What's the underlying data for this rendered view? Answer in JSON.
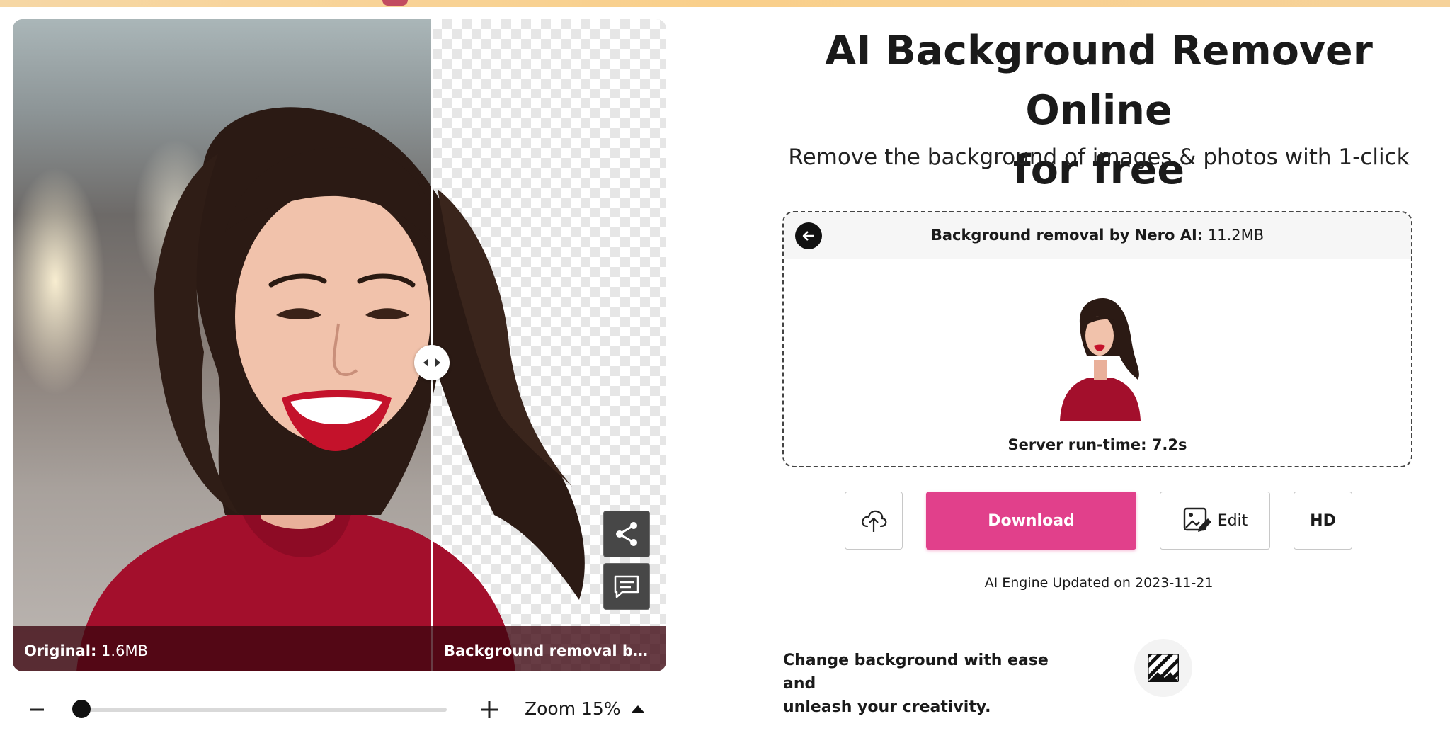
{
  "viewer": {
    "original_label": "Original:",
    "original_size": "1.6MB",
    "result_label": "Background removal by Nero AI",
    "share_icon": "share-icon",
    "feedback_icon": "comment-icon"
  },
  "zoom": {
    "label": "Zoom 15%",
    "value_percent": 15
  },
  "header": {
    "title_line1": "AI Background Remover Online",
    "title_line2": "for free",
    "subtitle": "Remove the background of images & photos with 1-click"
  },
  "result_card": {
    "title_bold": "Background removal by Nero AI:",
    "title_size": "11.2MB",
    "runtime": "Server run-time: 7.2s"
  },
  "actions": {
    "download_label": "Download",
    "edit_label": "Edit",
    "hd_label": "HD"
  },
  "engine_note": "AI Engine Updated on 2023-11-21",
  "promo": {
    "line1": "Change background with ease and",
    "line2": "unleash your creativity."
  },
  "colors": {
    "accent": "#e1408b",
    "top_bar": "#f9cf8a",
    "caption_bar": "#3c050f"
  }
}
